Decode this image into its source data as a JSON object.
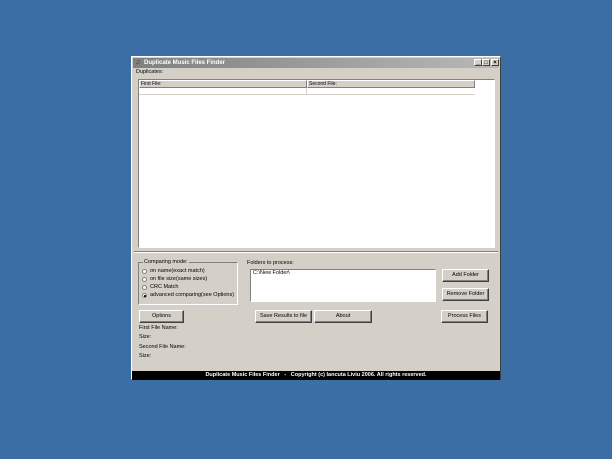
{
  "window": {
    "title": "Duplicate Music Files Finder",
    "minimize": "_",
    "maximize": "□",
    "close": "×"
  },
  "duplicates": {
    "label": "Duplicates:",
    "columns": [
      "First File:",
      "Second File:"
    ]
  },
  "comparing": {
    "title": "Comparing mode:",
    "options": [
      {
        "label": "on name(exact match)",
        "selected": false
      },
      {
        "label": "on file size(same sizes)",
        "selected": false
      },
      {
        "label": "CRC Match",
        "selected": false
      },
      {
        "label": "advanced comparing(see Options)",
        "selected": true
      }
    ]
  },
  "folders": {
    "label": "Folders to process:",
    "items": [
      "C:\\New Folder\\"
    ]
  },
  "buttons": {
    "add_folder": "Add Folder",
    "remove_folder": "Remove Folder",
    "options": "Options",
    "save_results": "Save Results to file",
    "about": "About",
    "process_files": "Process Files"
  },
  "info": {
    "first_name": "First File Name:",
    "first_size": "Size:",
    "second_name": "Second File Name:",
    "second_size": "Size:"
  },
  "status": {
    "title": "Duplicate Music Files Finder",
    "separator": "-",
    "copyright": "Copyright (c) Iancuta Liviu 2006. All rights reserved."
  }
}
